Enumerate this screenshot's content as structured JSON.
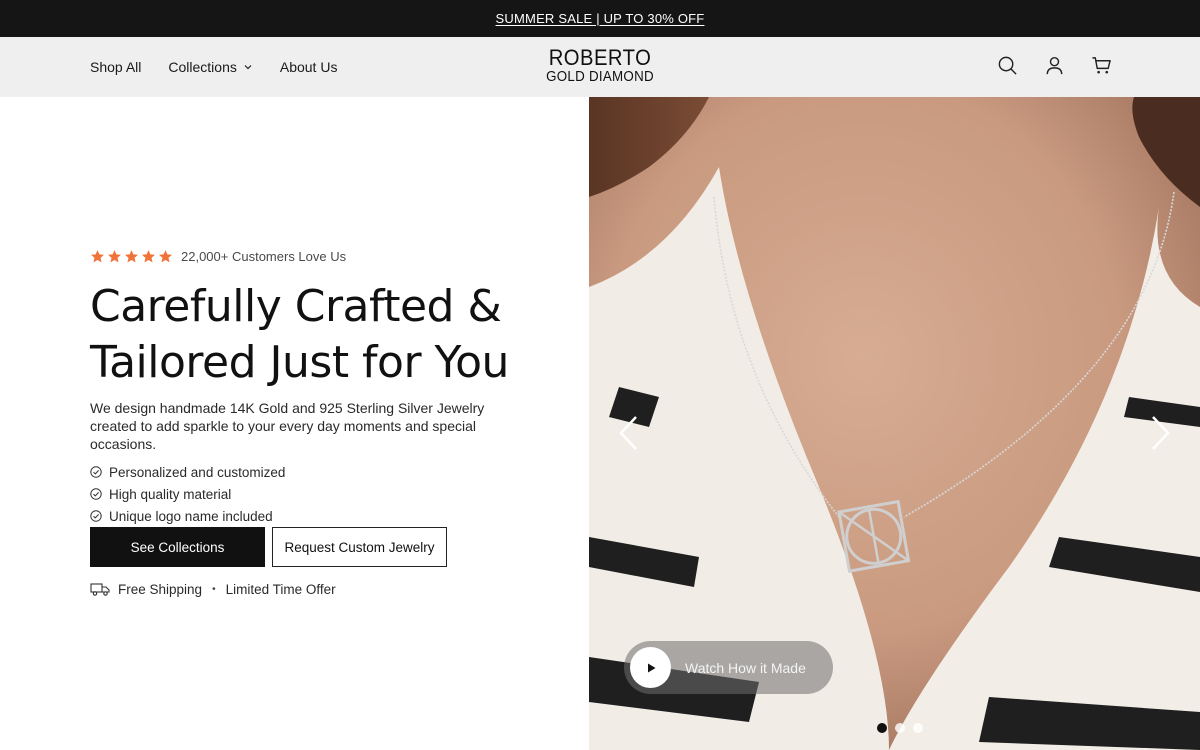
{
  "announcement": {
    "text": "SUMMER SALE  |  UP TO 30% OFF"
  },
  "header": {
    "nav": [
      {
        "label": "Shop All"
      },
      {
        "label": "Collections",
        "has_dropdown": true
      },
      {
        "label": "About Us"
      }
    ],
    "logo": {
      "line1": "ROBERTO",
      "line2": "GOLD DIAMOND"
    },
    "icons": [
      "search-icon",
      "account-icon",
      "cart-icon"
    ]
  },
  "hero": {
    "rating": {
      "stars": 5,
      "text": "22,000+ Customers Love Us",
      "star_color": "#f0733a"
    },
    "headline_line1": "Carefully Crafted &",
    "headline_line2": "Tailored Just for You",
    "description": "We design handmade 14K Gold and 925 Sterling Silver Jewelry created to add sparkle to your every day moments and special occasions.",
    "features": [
      "Personalized and customized",
      "High quality material",
      "Unique logo name included"
    ],
    "primary_button": "See Collections",
    "secondary_button": "Request Custom Jewelry",
    "shipping": {
      "text1": "Free Shipping",
      "separator": "•",
      "text2": "Limited Time Offer"
    }
  },
  "carousel": {
    "watch_label": "Watch How it Made",
    "slides": 3,
    "active_slide": 1
  },
  "colors": {
    "announcement_bg": "#151515",
    "header_bg": "#efefef",
    "star": "#f0733a",
    "primary_button_bg": "#111111"
  }
}
